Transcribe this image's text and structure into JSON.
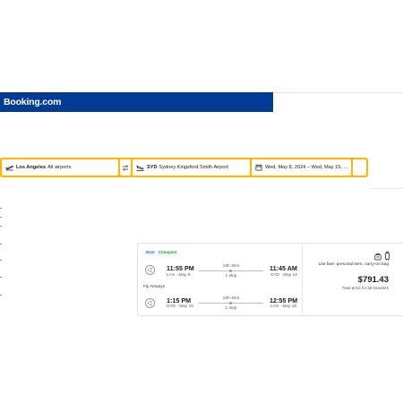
{
  "header": {
    "logo": "Booking.com",
    "bg_color": "#003b95"
  },
  "search": {
    "accent_color": "#ffb700",
    "from": {
      "code": "Los Angeles",
      "name": "All airports",
      "icon": "plane-takeoff-icon"
    },
    "swap_icon": "swap-arrows-icon",
    "to": {
      "code": "SYD",
      "name": "Sydney Kingsford Smith Airport",
      "icon": "plane-landing-icon"
    },
    "dates": {
      "text": "Wed, May 8, 2024 – Wed, May 15, 2…",
      "icon": "calendar-icon"
    }
  },
  "result": {
    "badges": [
      "Best",
      "Cheapest"
    ],
    "outbound": {
      "depart_time": "11:55 PM",
      "depart_sub": "LAX · May 8",
      "duration": "18h 30m",
      "stops": "1 stop",
      "arrive_time": "11:45 AM",
      "arrive_sub": "SYD · May 10"
    },
    "airline": "Fiji Airways",
    "return": {
      "depart_time": "1:15 PM",
      "depart_sub": "SYD · May 15",
      "duration": "16h 40m",
      "stops": "1 stop",
      "arrive_time": "12:55 PM",
      "arrive_sub": "LAX · May 15"
    },
    "fare": "Lite fare: personal item, carry-on bag",
    "price": "$791.43",
    "price_note": "Total price for all travelers"
  }
}
